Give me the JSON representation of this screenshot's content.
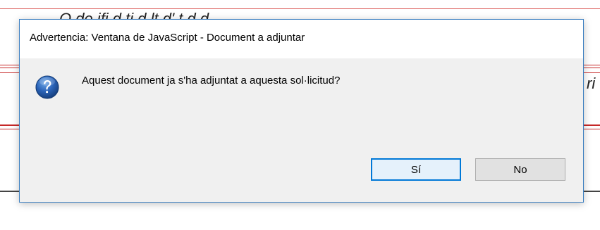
{
  "background": {
    "top_text": "O de                        ifi           d           ti           d         lt    d'          t d  d",
    "right_text": "ri",
    "line_color": "#c62828"
  },
  "dialog": {
    "title": "Advertencia: Ventana de JavaScript - Document a adjuntar",
    "icon": "question-icon",
    "message": "Aquest document ja s'ha adjuntat a aquesta sol·licitud?",
    "buttons": {
      "yes_label": "Sí",
      "no_label": "No"
    },
    "colors": {
      "border": "#3c7fc1",
      "body": "#f0f0f0",
      "focus": "#0078d7"
    }
  }
}
